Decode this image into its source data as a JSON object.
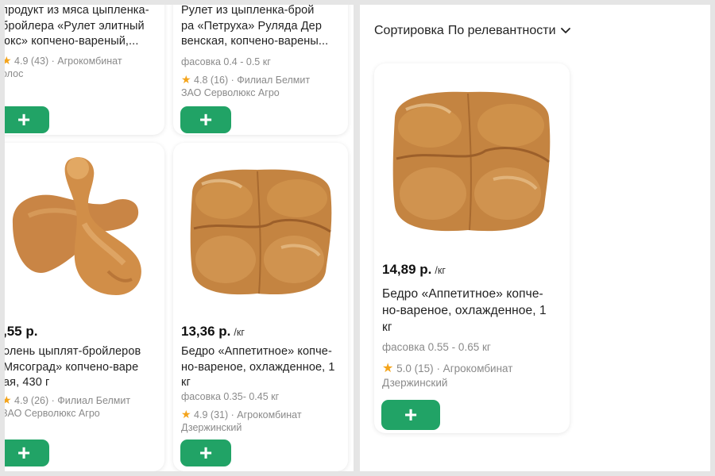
{
  "left": {
    "cards": [
      {
        "name_lines": [
          "продукт из мяса цыпленка-",
          "бройлера «Рулет элитный",
          "юкс» копчено-вареный,..."
        ],
        "rating": "4.9",
        "reviews": "(43)",
        "seller": "· Агрокомбинат",
        "seller2": "олос",
        "add_label": "+"
      },
      {
        "name_lines": [
          "Рулет из цыпленка-брой",
          "ра «Петруха» Руляда Дер",
          "венская, копчено-варены..."
        ],
        "weight": "фасовка 0.4 - 0.5 кг",
        "rating": "4.8",
        "reviews": "(16)",
        "seller": "· Филиал Белмит",
        "seller2": "ЗАО Серволюкс Агро",
        "add_label": "+"
      },
      {
        "price": ",55 р.",
        "name_lines": [
          "олень цыплят-бройлеров",
          "Мясоград» копчено-варе",
          "ая, 430 г"
        ],
        "rating": "4.9",
        "reviews": "(26)",
        "seller": "· Филиал Белмит",
        "seller2": "ЗАО Серволюкс Агро",
        "add_label": "+"
      },
      {
        "price": "13,36 р.",
        "unit": "/кг",
        "name_lines": [
          "Бедро «Аппетитное» копче-",
          "но-вареное, охлажденное, 1",
          "кг"
        ],
        "weight": "фасовка 0.35- 0.45 кг",
        "rating": "4.9",
        "reviews": "(31)",
        "seller": "· Агрокомбинат",
        "seller2": "Дзержинский",
        "add_label": "+"
      }
    ]
  },
  "right": {
    "sort": {
      "label": "Сортировка",
      "value": "По релевантности"
    },
    "card": {
      "price": "14,89 р.",
      "unit": "/кг",
      "name_lines": [
        "Бедро «Аппетитное» копче-",
        "но-вареное, охлажденное, 1",
        "кг"
      ],
      "weight": "фасовка 0.55 - 0.65 кг",
      "rating": "5.0",
      "reviews": "(15)",
      "seller": "· Агрокомбинат",
      "seller2": "Дзержинский",
      "add_label": "+"
    }
  },
  "colors": {
    "accent": "#21a366",
    "star": "#f4a41b",
    "meta": "#8a8a8a"
  },
  "icons": {
    "star": "star-icon",
    "add": "plus-icon",
    "chevron": "chevron-down-icon"
  }
}
